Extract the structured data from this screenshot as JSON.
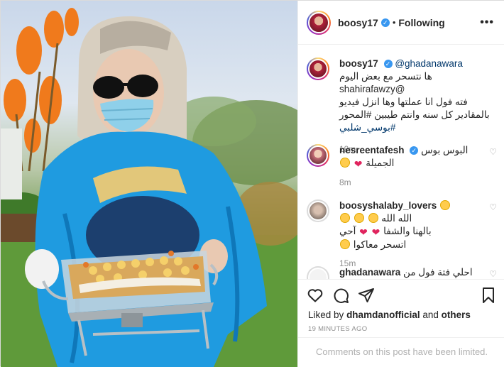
{
  "header": {
    "username": "boosy17",
    "verified_icon": "verified-badge-icon",
    "separator": "•",
    "follow_status": "Following",
    "more_label": "•••"
  },
  "caption": {
    "username": "boosy17",
    "mention": "@ghadanawara",
    "line1": "ها نتسحر مع بعض اليوم @shahirafawzy",
    "line2": "فته فول انا عملتها وها انزل فيديو",
    "line3": "بالمقادير كل سنه وانتم طيبين #المحور",
    "line4": "#بوسي_شلبي",
    "time": "19m"
  },
  "comments": [
    {
      "username": "nesreentafesh",
      "line1": "البوس بوس",
      "line2": "الجميلة",
      "time": "8m"
    },
    {
      "username": "boosyshalaby_lovers",
      "line1": "الله الله",
      "line2": "بالهنا والشفا",
      "line2b": "آحي",
      "line3": "اتسحر معاكوا",
      "time": "15m"
    },
    {
      "username": "ghadanawara",
      "line1": "احلي فتة فول من"
    }
  ],
  "actions": {
    "likes_prefix": "Liked by",
    "likes_user": "dhamdanofficial",
    "likes_and": "and",
    "likes_others": "others",
    "time_ago": "19 MINUTES AGO",
    "limited_notice": "Comments on this post have been limited."
  },
  "colors": {
    "link": "#00376b",
    "verified": "#3897f0",
    "muted": "#8e8e8e",
    "heart": "#e0245e"
  }
}
